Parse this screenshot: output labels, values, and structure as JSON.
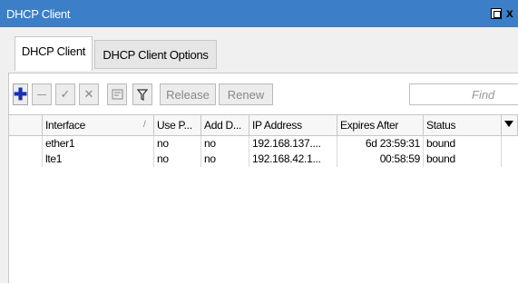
{
  "window": {
    "title": "DHCP Client",
    "close_glyph": "x"
  },
  "tabs": [
    {
      "label": "DHCP Client",
      "active": true
    },
    {
      "label": "DHCP Client Options",
      "active": false
    }
  ],
  "toolbar": {
    "add_icon": "plus-icon",
    "remove_icon": "minus-icon",
    "enable_icon": "check-icon",
    "disable_icon": "cross-icon",
    "comment_icon": "comment-icon",
    "filter_icon": "filter-icon",
    "release_label": "Release",
    "renew_label": "Renew",
    "find_placeholder": "Find"
  },
  "table": {
    "columns": [
      "",
      "Interface",
      "Use P...",
      "Add D...",
      "IP Address",
      "Expires After",
      "Status"
    ],
    "sort_indicator": "/",
    "rows": [
      {
        "flag": "",
        "interface": "ether1",
        "use_peer": "no",
        "add_default": "no",
        "ip_address": "192.168.137....",
        "expires_after": "6d 23:59:31",
        "status": "bound"
      },
      {
        "flag": "",
        "interface": "lte1",
        "use_peer": "no",
        "add_default": "no",
        "ip_address": "192.168.42.1...",
        "expires_after": "00:58:59",
        "status": "bound"
      }
    ]
  },
  "colors": {
    "titlebar": "#3c7fc8",
    "add_icon": "#1a2fb5"
  }
}
